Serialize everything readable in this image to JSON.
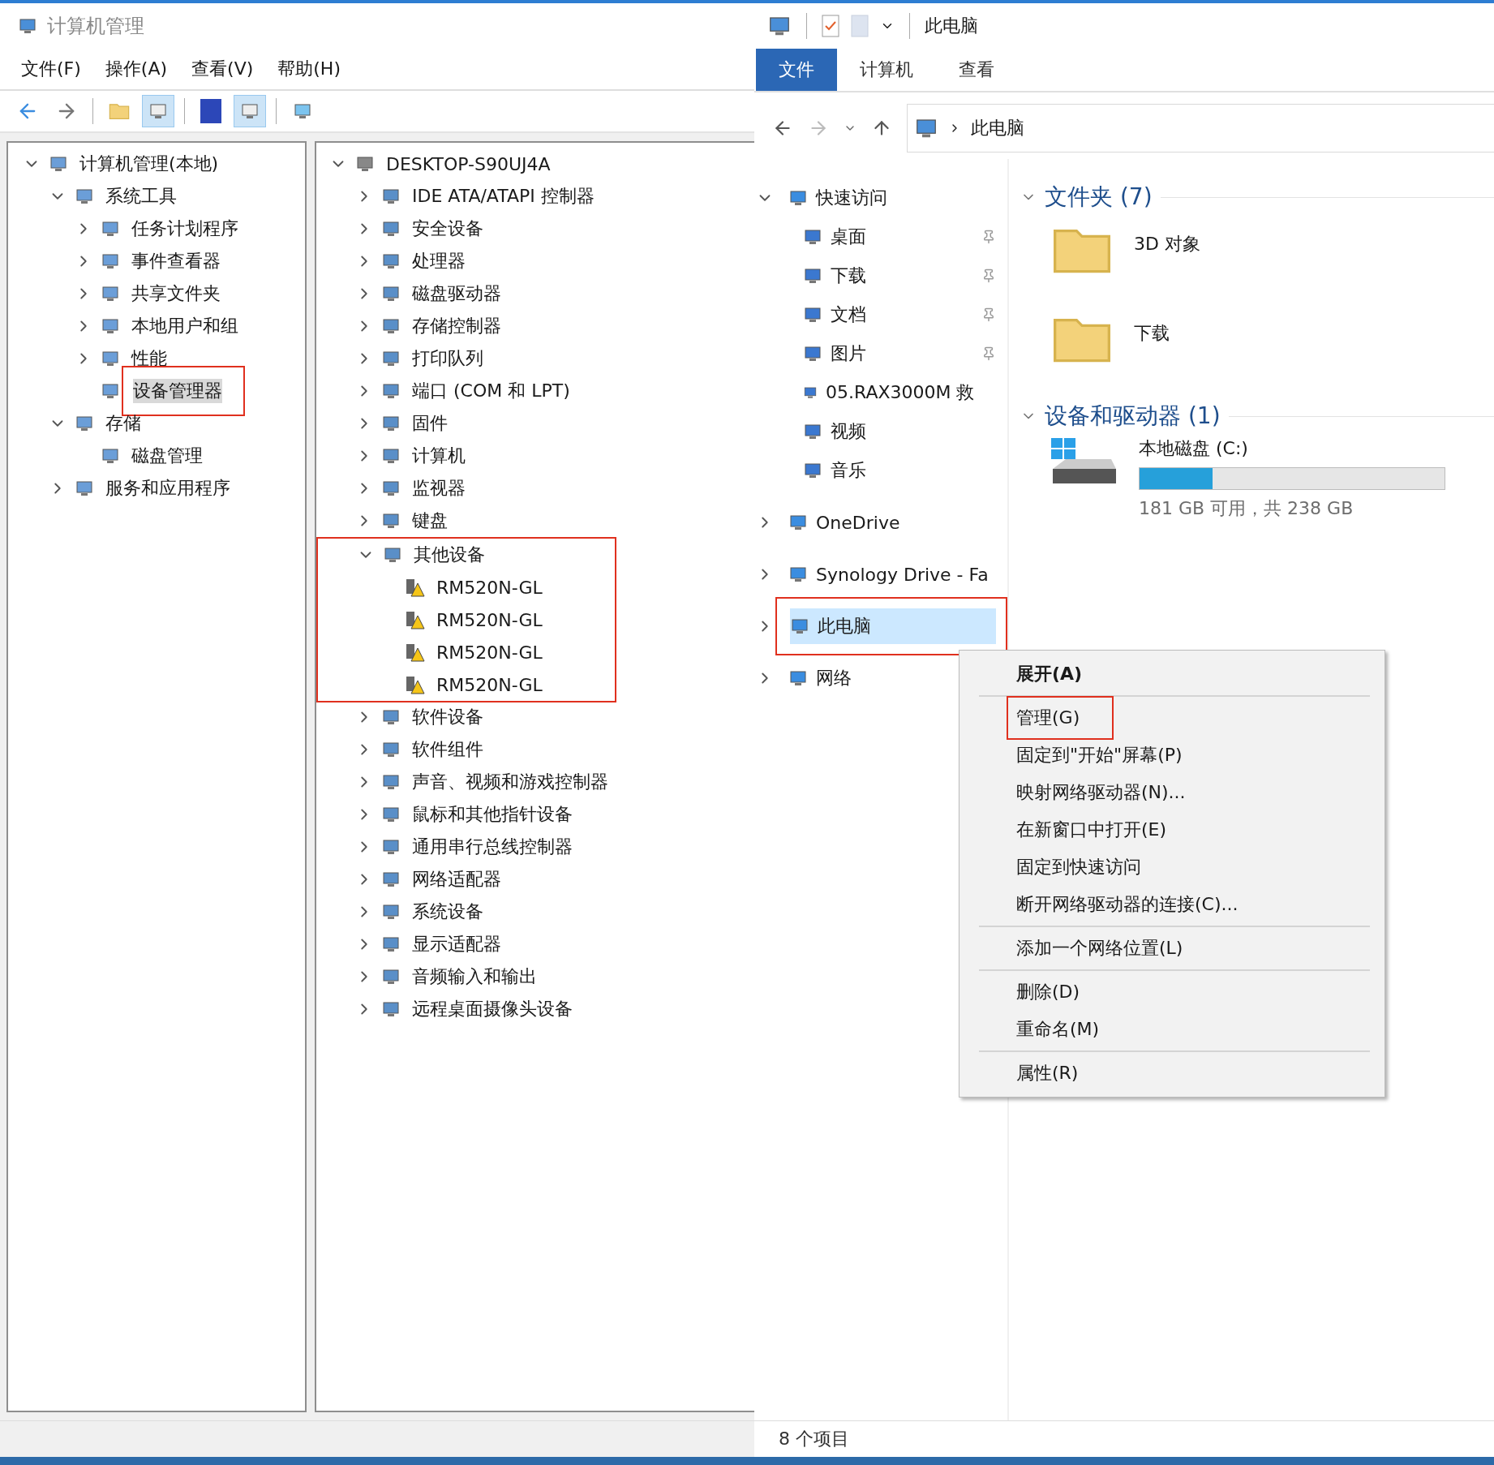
{
  "mmc": {
    "title": "计算机管理",
    "menu": [
      "文件(F)",
      "操作(A)",
      "查看(V)",
      "帮助(H)"
    ],
    "tree": [
      {
        "label": "计算机管理(本地)",
        "expanded": true,
        "selected": false,
        "highlighted": false,
        "children": [
          {
            "label": "系统工具",
            "expanded": true,
            "selected": false,
            "highlighted": false,
            "children": [
              {
                "label": "任务计划程序",
                "expanded": false,
                "selected": false,
                "highlighted": false
              },
              {
                "label": "事件查看器",
                "expanded": false,
                "selected": false,
                "highlighted": false
              },
              {
                "label": "共享文件夹",
                "expanded": false,
                "selected": false,
                "highlighted": false
              },
              {
                "label": "本地用户和组",
                "expanded": false,
                "selected": false,
                "highlighted": false
              },
              {
                "label": "性能",
                "expanded": false,
                "selected": false,
                "highlighted": false
              },
              {
                "label": "设备管理器",
                "selected": true,
                "highlighted": true
              }
            ]
          },
          {
            "label": "存储",
            "expanded": true,
            "selected": false,
            "highlighted": false,
            "children": [
              {
                "label": "磁盘管理",
                "selected": false,
                "highlighted": false
              }
            ]
          },
          {
            "label": "服务和应用程序",
            "expanded": false,
            "selected": false,
            "highlighted": false
          }
        ]
      }
    ],
    "devices": {
      "label": "DESKTOP-S90UJ4A",
      "expanded": true,
      "children": [
        {
          "label": "IDE ATA/ATAPI 控制器",
          "expanded": false,
          "highlighted": false
        },
        {
          "label": "安全设备",
          "expanded": false,
          "highlighted": false
        },
        {
          "label": "处理器",
          "expanded": false,
          "highlighted": false
        },
        {
          "label": "磁盘驱动器",
          "expanded": false,
          "highlighted": false
        },
        {
          "label": "存储控制器",
          "expanded": false,
          "highlighted": false
        },
        {
          "label": "打印队列",
          "expanded": false,
          "highlighted": false
        },
        {
          "label": "端口 (COM 和 LPT)",
          "expanded": false,
          "highlighted": false
        },
        {
          "label": "固件",
          "expanded": false,
          "highlighted": false
        },
        {
          "label": "计算机",
          "expanded": false,
          "highlighted": false
        },
        {
          "label": "监视器",
          "expanded": false,
          "highlighted": false
        },
        {
          "label": "键盘",
          "expanded": false,
          "highlighted": false
        },
        {
          "label": "其他设备",
          "expanded": true,
          "highlighted": true,
          "children": [
            {
              "label": "RM520N-GL",
              "warning": true
            },
            {
              "label": "RM520N-GL",
              "warning": true
            },
            {
              "label": "RM520N-GL",
              "warning": true
            },
            {
              "label": "RM520N-GL",
              "warning": true
            }
          ]
        },
        {
          "label": "软件设备",
          "expanded": false,
          "highlighted": false
        },
        {
          "label": "软件组件",
          "expanded": false,
          "highlighted": false
        },
        {
          "label": "声音、视频和游戏控制器",
          "expanded": false,
          "highlighted": false
        },
        {
          "label": "鼠标和其他指针设备",
          "expanded": false,
          "highlighted": false
        },
        {
          "label": "通用串行总线控制器",
          "expanded": false,
          "highlighted": false
        },
        {
          "label": "网络适配器",
          "expanded": false,
          "highlighted": false
        },
        {
          "label": "系统设备",
          "expanded": false,
          "highlighted": false
        },
        {
          "label": "显示适配器",
          "expanded": false,
          "highlighted": false
        },
        {
          "label": "音频输入和输出",
          "expanded": false,
          "highlighted": false
        },
        {
          "label": "远程桌面摄像头设备",
          "expanded": false,
          "highlighted": false
        }
      ]
    }
  },
  "explorer": {
    "title": "此电脑",
    "tabs": [
      {
        "label": "文件",
        "selected": true
      },
      {
        "label": "计算机",
        "selected": false
      },
      {
        "label": "查看",
        "selected": false
      }
    ],
    "breadcrumb": "此电脑",
    "nav": [
      {
        "label": "快速访问",
        "expanded": true,
        "selected": false,
        "highlighted": false,
        "children": [
          {
            "label": "桌面",
            "pinned": true
          },
          {
            "label": "下载",
            "pinned": true
          },
          {
            "label": "文档",
            "pinned": true
          },
          {
            "label": "图片",
            "pinned": true
          },
          {
            "label": "05.RAX3000M 救",
            "pinned": false
          },
          {
            "label": "视频",
            "pinned": false
          },
          {
            "label": "音乐",
            "pinned": false
          }
        ]
      },
      {
        "label": "OneDrive",
        "expanded": false,
        "selected": false,
        "highlighted": false
      },
      {
        "label": "Synology Drive - Fa",
        "expanded": false,
        "selected": false,
        "highlighted": false
      },
      {
        "label": "此电脑",
        "expanded": false,
        "selected": true,
        "highlighted": true
      },
      {
        "label": "网络",
        "expanded": false,
        "selected": false,
        "highlighted": false
      }
    ],
    "folders": {
      "title": "文件夹 (7)",
      "items": [
        "3D 对象",
        "下载"
      ]
    },
    "drives": {
      "title": "设备和驱动器 (1)",
      "items": [
        {
          "name": "本地磁盘 (C:)",
          "level": 0.24,
          "space": "181 GB 可用，共 238 GB"
        }
      ]
    },
    "status": "8 个项目"
  },
  "context_menu": [
    [
      {
        "label": "展开(A)",
        "bold": true,
        "highlighted": false
      }
    ],
    [
      {
        "label": "管理(G)",
        "bold": false,
        "highlighted": true
      },
      {
        "label": "固定到\"开始\"屏幕(P)",
        "bold": false,
        "highlighted": false
      },
      {
        "label": "映射网络驱动器(N)...",
        "bold": false,
        "highlighted": false
      },
      {
        "label": "在新窗口中打开(E)",
        "bold": false,
        "highlighted": false
      },
      {
        "label": "固定到快速访问",
        "bold": false,
        "highlighted": false
      },
      {
        "label": "断开网络驱动器的连接(C)...",
        "bold": false,
        "highlighted": false
      }
    ],
    [
      {
        "label": "添加一个网络位置(L)",
        "bold": false,
        "highlighted": false
      }
    ],
    [
      {
        "label": "删除(D)",
        "bold": false,
        "highlighted": false
      },
      {
        "label": "重命名(M)",
        "bold": false,
        "highlighted": false
      }
    ],
    [
      {
        "label": "属性(R)",
        "bold": false,
        "highlighted": false
      }
    ]
  ]
}
